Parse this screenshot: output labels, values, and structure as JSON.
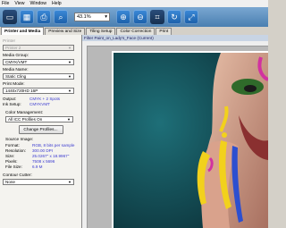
{
  "menu": [
    "File",
    "View",
    "Window",
    "Help"
  ],
  "toolbar": {
    "zoom_value": "43.1%"
  },
  "tabs": [
    {
      "label": "Printer and Media",
      "active": true
    },
    {
      "label": "Preview and Size"
    },
    {
      "label": "Tiling Setup"
    },
    {
      "label": "Color Correction"
    },
    {
      "label": "Print"
    }
  ],
  "settings": {
    "printer_label": "Printer",
    "printer_value": "Printer 2",
    "media_group_label": "Media Group:",
    "media_group_value": "CMYK/VMT",
    "media_name_label": "Media Name:",
    "media_name_value": "Static Cling",
    "print_mode_label": "Print Mode:",
    "print_mode_value": "1440x720HD 16P",
    "output_label": "Output:",
    "output_value": "CMYK + 2 Spots",
    "ink_setup_label": "Ink Setup:",
    "ink_setup_value": "CMYKVMT",
    "color_mgmt_label": "Color Management:",
    "color_mgmt_value": "All ICC Profiles On",
    "change_profiles_label": "Change Profiles...",
    "source_image_label": "Source Image:",
    "source_image": [
      {
        "k": "Format:",
        "v": "RGB, 8 bits per sample"
      },
      {
        "k": "Resolution:",
        "v": "300.00 DPI"
      },
      {
        "k": "Size:",
        "v": "25.0267\" x 18.9967\""
      },
      {
        "k": "Pixels:",
        "v": "7508 x 5696"
      },
      {
        "k": "File Size:",
        "v": "6.9 M"
      }
    ],
    "contour_cutter_label": "Contour Cutter:",
    "contour_cutter_value": "None"
  },
  "canvas": {
    "title": "Filter Paint_on_Lady's_Face (Current)"
  }
}
